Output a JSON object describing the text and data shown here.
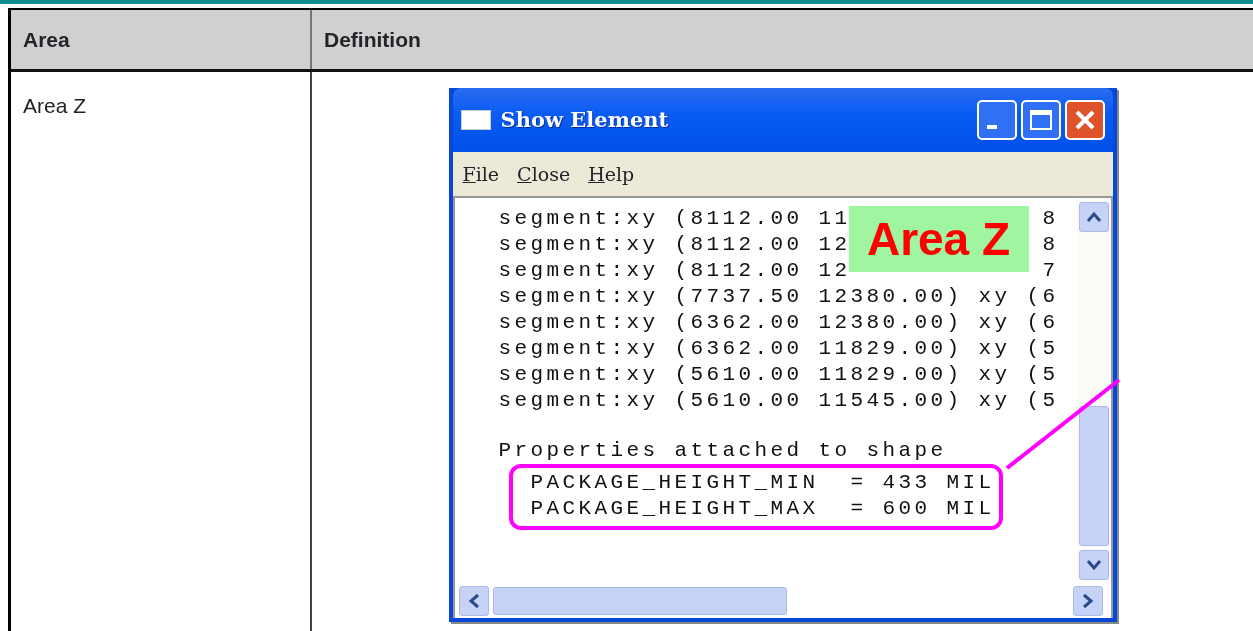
{
  "table": {
    "columns": [
      "Area",
      "Definition"
    ],
    "rows": [
      {
        "area": "Area Z",
        "screenshot": {
          "window": {
            "title": "Show Element",
            "menu": [
              "File",
              "Close",
              "Help"
            ],
            "lines": [
              {
                "text": "segment:xy (8112.00 11",
                "tail": "8"
              },
              {
                "text": "segment:xy (8112.00 12",
                "tail": "8"
              },
              {
                "text": "segment:xy (8112.00 12",
                "tail": "7"
              },
              {
                "text": "segment:xy (7737.50 12380.00) xy (6"
              },
              {
                "text": "segment:xy (6362.00 12380.00) xy (6"
              },
              {
                "text": "segment:xy (6362.00 11829.00) xy (5"
              },
              {
                "text": "segment:xy (5610.00 11829.00) xy (5"
              },
              {
                "text": "segment:xy (5610.00 11545.00) xy (5"
              }
            ],
            "properties_heading": "Properties attached to shape",
            "properties": [
              "PACKAGE_HEIGHT_MIN  = 433 MIL",
              "PACKAGE_HEIGHT_MAX  = 600 MIL"
            ]
          },
          "label": "Area Z"
        }
      }
    ]
  }
}
